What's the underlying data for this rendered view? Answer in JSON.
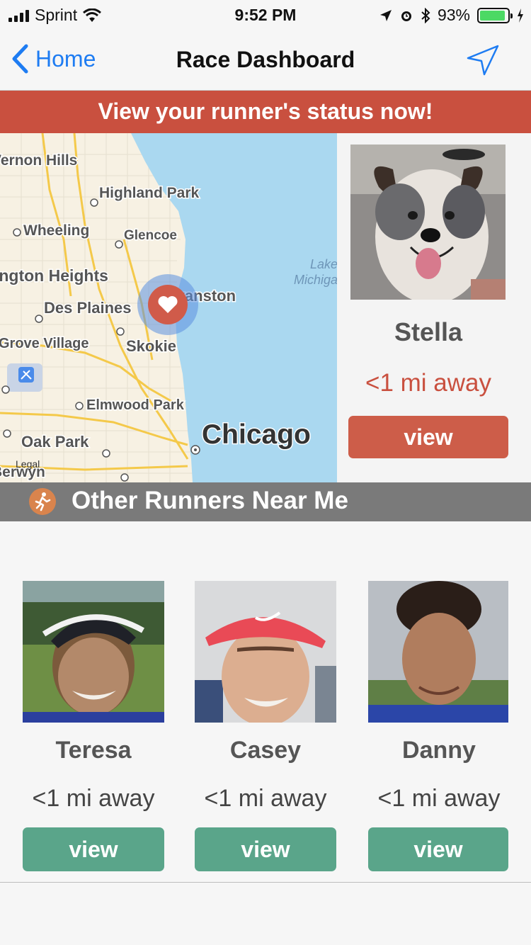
{
  "status_bar": {
    "carrier": "Sprint",
    "time": "9:52 PM",
    "battery_percent": "93%",
    "battery_level": 0.93
  },
  "nav": {
    "back_label": "Home",
    "title": "Race Dashboard",
    "action_icon": "location-arrow-icon"
  },
  "banner": {
    "text": "View your runner's status now!"
  },
  "map": {
    "labels": {
      "vernon_hills": "Vernon Hills",
      "highland_park": "Highland Park",
      "wheeling": "Wheeling",
      "glencoe": "Glencoe",
      "arlington_heights": "Arlington Heights",
      "lake_michigan_1": "Lake",
      "lake_michigan_2": "Michigan",
      "evanston": "Evanston",
      "des_plaines": "Des Plaines",
      "grove_village": "Grove Village",
      "skokie": "Skokie",
      "elmwood_park": "Elmwood Park",
      "chicago": "Chicago",
      "oak_park": "Oak Park",
      "berwyn": "Berwyn",
      "legal": "Legal"
    },
    "colors": {
      "land": "#f7f1e3",
      "water": "#aad8f0",
      "highway": "#f4c94a",
      "pin": "#d05b4a"
    }
  },
  "featured_runner": {
    "name": "Stella",
    "distance": "<1 mi away",
    "view_label": "view"
  },
  "section": {
    "title": "Other Runners Near Me",
    "icon": "runner-icon"
  },
  "runners": [
    {
      "name": "Teresa",
      "distance": "<1 mi away",
      "view_label": "view"
    },
    {
      "name": "Casey",
      "distance": "<1 mi away",
      "view_label": "view"
    },
    {
      "name": "Danny",
      "distance": "<1 mi away",
      "view_label": "view"
    }
  ],
  "colors": {
    "accent_blue": "#1e7cf2",
    "banner_red": "#c9503f",
    "view_red": "#cd5d49",
    "view_green": "#5aa58a",
    "section_gray": "#7a7a7a"
  }
}
